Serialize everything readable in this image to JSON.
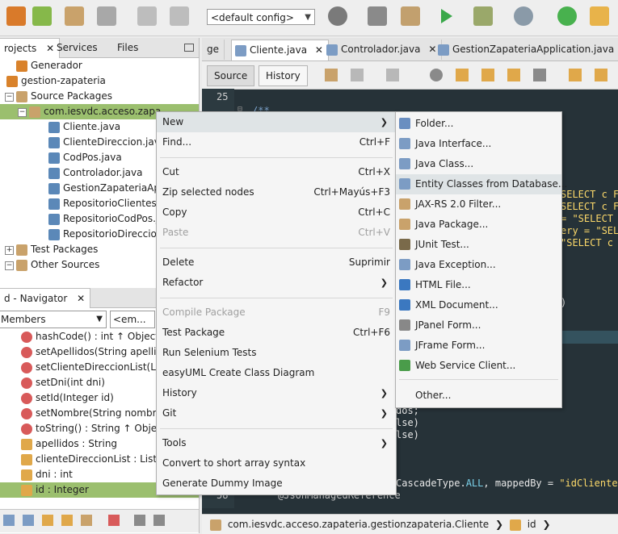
{
  "toolbar": {
    "config_value": "<default config>",
    "icons": [
      "new-project-icon",
      "new-file-icon",
      "open-project-icon",
      "save-all-icon",
      "undo-icon",
      "redo-icon",
      "config-combo",
      "globe-icon",
      "build-hammer-icon",
      "clean-build-icon",
      "run-icon",
      "debug-icon",
      "profile-icon",
      "power-icon",
      "jar-icon"
    ]
  },
  "left_tabs": [
    "rojects",
    "Services",
    "Files"
  ],
  "tree": [
    {
      "label": "Generador",
      "icon": "#d9822b"
    },
    {
      "label": "gestion-zapateria",
      "icon": "#d9822b"
    },
    {
      "label": "Source Packages",
      "icon": "#c9a26b"
    },
    {
      "label": "com.iesvdc.acceso.zapa",
      "icon": "#c9a26b"
    },
    {
      "label": "Cliente.java",
      "icon": "#5b88b8"
    },
    {
      "label": "ClienteDireccion.java",
      "icon": "#5b88b8"
    },
    {
      "label": "CodPos.java",
      "icon": "#5b88b8"
    },
    {
      "label": "Controlador.java",
      "icon": "#5b88b8"
    },
    {
      "label": "GestionZapateriaApp",
      "icon": "#5b88b8"
    },
    {
      "label": "RepositorioClientes.ja",
      "icon": "#5b88b8"
    },
    {
      "label": "RepositorioCodPos.ja",
      "icon": "#5b88b8"
    },
    {
      "label": "RepositorioDireccion",
      "icon": "#5b88b8"
    },
    {
      "label": "Test Packages",
      "icon": "#c9a26b"
    },
    {
      "label": "Other Sources",
      "icon": "#c9a26b"
    }
  ],
  "navigator": {
    "title": "d - Navigator",
    "filter_value": "Members",
    "filter2_value": "<em...",
    "items": [
      {
        "label": "hashCode() : int ↑ Object",
        "icon": "#d85a5a"
      },
      {
        "label": "setApellidos(String apellid",
        "icon": "#d85a5a"
      },
      {
        "label": "setClienteDireccionList(List",
        "icon": "#d85a5a"
      },
      {
        "label": "setDni(int dni)",
        "icon": "#d85a5a"
      },
      {
        "label": "setId(Integer id)",
        "icon": "#d85a5a"
      },
      {
        "label": "setNombre(String nombre",
        "icon": "#d85a5a"
      },
      {
        "label": "toString() : String ↑ Object",
        "icon": "#d85a5a"
      },
      {
        "label": "apellidos : String",
        "icon": "#e0a84a"
      },
      {
        "label": "clienteDireccionList : List<",
        "icon": "#e0a84a"
      },
      {
        "label": "dni : int",
        "icon": "#e0a84a"
      },
      {
        "label": "id : Integer",
        "icon": "#e0a84a"
      }
    ]
  },
  "editor_tabs": [
    "ge",
    "Cliente.java",
    "Controlador.java",
    "GestionZapateriaApplication.java"
  ],
  "editor_toolbar": {
    "source": "Source",
    "history": "History"
  },
  "code": {
    "line_25": "25",
    "line_58": "58",
    "comment_start": "/**",
    "l1": "SELECT c FROM",
    "l2": "SELECT c F",
    "l3": "= \"SELECT",
    "l4": "ery = \"SEL",
    "l5": "\"SELECT c",
    "l6": ")",
    "l7": "dos;",
    "l8": "lse)",
    "l9": "lse)",
    "l10_a": "CascadeType.",
    "l10_b": "ALL",
    "l10_c": ", mappedBy = ",
    "l10_d": "\"idCliente\"",
    "l11": "@JsonManagedReference"
  },
  "breadcrumb": {
    "path": "com.iesvdc.acceso.zapateria.gestionzapateria.Cliente",
    "member": "id"
  },
  "context_menu": [
    {
      "label": "New",
      "shortcut": "",
      "submenu": true,
      "disabled": false
    },
    {
      "label": "Find...",
      "shortcut": "Ctrl+F",
      "submenu": false,
      "disabled": false
    },
    {
      "sep": true
    },
    {
      "label": "Cut",
      "shortcut": "Ctrl+X",
      "submenu": false,
      "disabled": false
    },
    {
      "label": "Zip selected nodes",
      "shortcut": "Ctrl+Mayús+F3",
      "submenu": false,
      "disabled": false
    },
    {
      "label": "Copy",
      "shortcut": "Ctrl+C",
      "submenu": false,
      "disabled": false
    },
    {
      "label": "Paste",
      "shortcut": "Ctrl+V",
      "submenu": false,
      "disabled": true
    },
    {
      "sep": true
    },
    {
      "label": "Delete",
      "shortcut": "Suprimir",
      "submenu": false,
      "disabled": false
    },
    {
      "label": "Refactor",
      "shortcut": "",
      "submenu": true,
      "disabled": false
    },
    {
      "sep": true
    },
    {
      "label": "Compile Package",
      "shortcut": "F9",
      "submenu": false,
      "disabled": true
    },
    {
      "label": "Test Package",
      "shortcut": "Ctrl+F6",
      "submenu": false,
      "disabled": false
    },
    {
      "label": "Run Selenium Tests",
      "shortcut": "",
      "submenu": false,
      "disabled": false
    },
    {
      "label": "easyUML Create Class Diagram",
      "shortcut": "",
      "submenu": false,
      "disabled": false
    },
    {
      "label": "History",
      "shortcut": "",
      "submenu": true,
      "disabled": false
    },
    {
      "label": "Git",
      "shortcut": "",
      "submenu": true,
      "disabled": false
    },
    {
      "sep": true
    },
    {
      "label": "Tools",
      "shortcut": "",
      "submenu": true,
      "disabled": false
    },
    {
      "label": "Convert to short array syntax",
      "shortcut": "",
      "submenu": false,
      "disabled": false
    },
    {
      "label": "Generate Dummy Image",
      "shortcut": "",
      "submenu": false,
      "disabled": false
    }
  ],
  "submenu": [
    {
      "label": "Folder...",
      "icon": "#6a8ec0"
    },
    {
      "label": "Java Interface...",
      "icon": "#7c9cc4"
    },
    {
      "label": "Java Class...",
      "icon": "#7c9cc4"
    },
    {
      "label": "Entity Classes from Database...",
      "icon": "#7c9cc4"
    },
    {
      "label": "JAX-RS 2.0 Filter...",
      "icon": "#c9a26b"
    },
    {
      "label": "Java Package...",
      "icon": "#c9a26b"
    },
    {
      "label": "JUnit Test...",
      "icon": "#7a6a4a"
    },
    {
      "label": "Java Exception...",
      "icon": "#7c9cc4"
    },
    {
      "label": "HTML File...",
      "icon": "#3b78c0"
    },
    {
      "label": "XML Document...",
      "icon": "#3b78c0"
    },
    {
      "label": "JPanel Form...",
      "icon": "#888888"
    },
    {
      "label": "JFrame Form...",
      "icon": "#7c9cc4"
    },
    {
      "label": "Web Service Client...",
      "icon": "#4a9c4a"
    },
    {
      "label": "Other...",
      "icon": ""
    }
  ]
}
